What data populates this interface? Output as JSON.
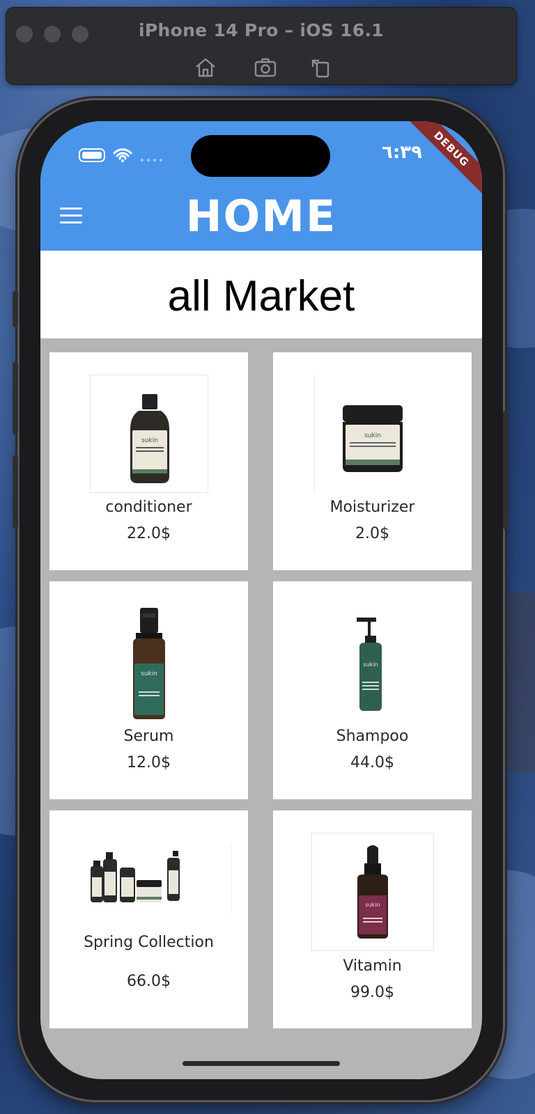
{
  "simulator": {
    "title": "iPhone 14 Pro – iOS 16.1",
    "icons": [
      "home-icon",
      "screenshot-icon",
      "rotate-icon"
    ]
  },
  "status_bar": {
    "time": "٦:٣٩",
    "debug_banner": "DEBUG"
  },
  "appbar": {
    "title": "HOME"
  },
  "headline": "all Market",
  "products": [
    {
      "name": "conditioner",
      "price": "22.0$"
    },
    {
      "name": "Moisturizer",
      "price": "2.0$"
    },
    {
      "name": "Serum",
      "price": "12.0$"
    },
    {
      "name": "Shampoo",
      "price": "44.0$"
    },
    {
      "name": "Spring Collection",
      "price": "66.0$"
    },
    {
      "name": "Vitamin",
      "price": "99.0$"
    }
  ],
  "colors": {
    "appbar": "#4a94ea",
    "background": "#b5b5b5",
    "card": "#ffffff"
  }
}
